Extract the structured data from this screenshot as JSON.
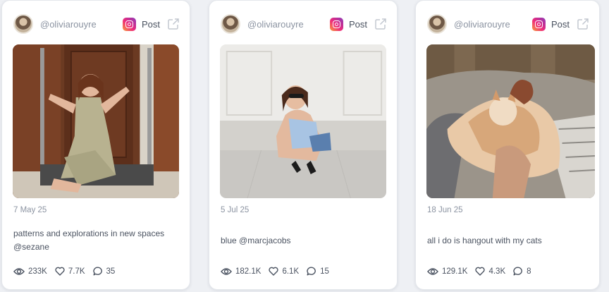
{
  "posts": [
    {
      "handle": "@oliviarouyre",
      "platform": "Post",
      "date": "7 May 25",
      "caption": "patterns and explorations in new spaces @sezane",
      "views": "233K",
      "likes": "7.7K",
      "comments": "35",
      "photo": "woman-in-plaid-dress-on-luggage-cart"
    },
    {
      "handle": "@oliviarouyre",
      "platform": "Post",
      "date": "5 Jul 25",
      "caption": "blue @marcjacobs",
      "views": "182.1K",
      "likes": "6.1K",
      "comments": "15",
      "photo": "woman-crouching-with-blue-bag"
    },
    {
      "handle": "@oliviarouyre",
      "platform": "Post",
      "date": "18 Jun 25",
      "caption": "all i do is hangout with my cats",
      "views": "129.1K",
      "likes": "4.3K",
      "comments": "8",
      "photo": "orange-cat-sleeping-on-blanket"
    }
  ],
  "colors": {
    "background": "#eef0f4",
    "card": "#ffffff",
    "muted_text": "#8b93a1",
    "body_text": "#4a5260"
  },
  "icons": [
    "instagram-icon",
    "external-link-icon",
    "eye-icon",
    "heart-icon",
    "comment-icon"
  ]
}
